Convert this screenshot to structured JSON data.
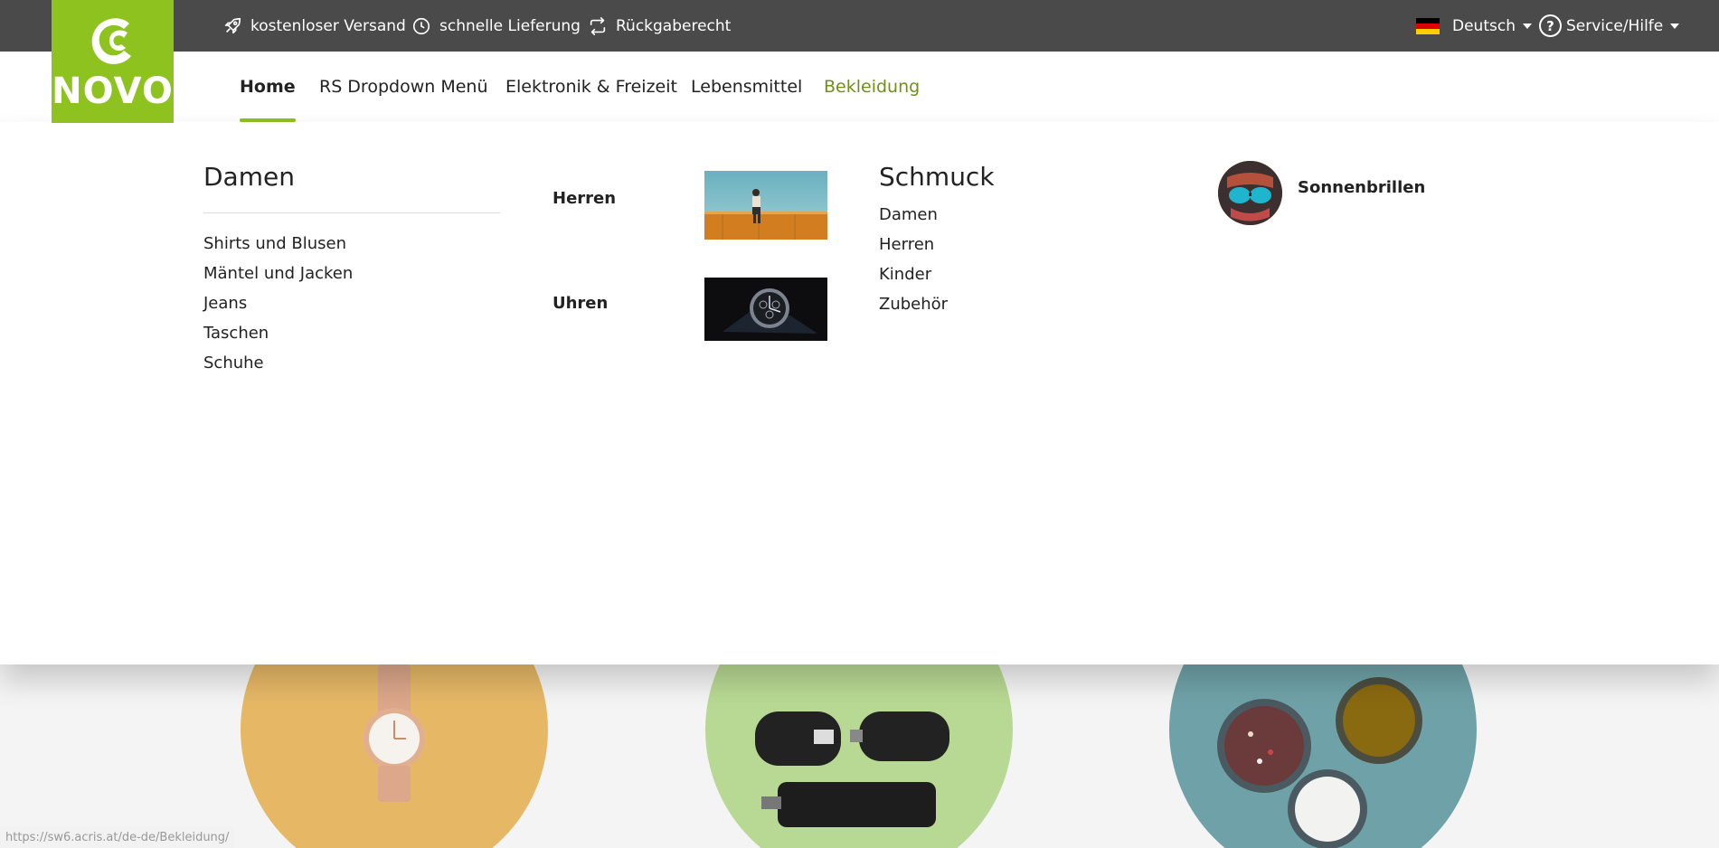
{
  "topbar": {
    "usps": [
      {
        "label": "kostenloser Versand",
        "icon": "rocket-icon"
      },
      {
        "label": "schnelle Lieferung",
        "icon": "clock-icon"
      },
      {
        "label": "Rückgaberecht",
        "icon": "return-icon"
      }
    ],
    "language": "Deutsch",
    "service": "Service/Hilfe"
  },
  "logo": {
    "text": "NOVO",
    "color": "#8dc21f"
  },
  "nav": {
    "items": [
      {
        "label": "Home",
        "active": true
      },
      {
        "label": "RS Dropdown Menü"
      },
      {
        "label": "Elektronik & Freizeit"
      },
      {
        "label": "Lebensmittel"
      },
      {
        "label": "Bekleidung",
        "hovered": true
      }
    ]
  },
  "flyout": {
    "damen": {
      "title": "Damen",
      "items": [
        "Shirts und Blusen",
        "Mäntel und Jacken",
        "Jeans",
        "Taschen",
        "Schuhe"
      ]
    },
    "featured": [
      {
        "label": "Herren"
      },
      {
        "label": "Uhren"
      }
    ],
    "schmuck": {
      "title": "Schmuck",
      "items": [
        "Damen",
        "Herren",
        "Kinder",
        "Zubehör"
      ]
    },
    "sonnenbrillen": {
      "label": "Sonnenbrillen"
    }
  },
  "status_url": "https://sw6.acris.at/de-de/Bekleidung/",
  "colors": {
    "accent": "#8dc21f",
    "topbar": "#4a4a4a",
    "hover": "#6f8f1d"
  }
}
